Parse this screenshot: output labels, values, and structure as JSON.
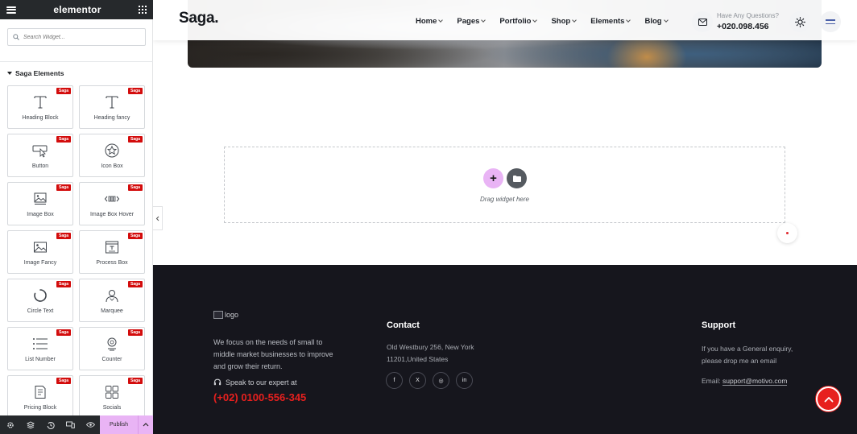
{
  "panel": {
    "title": "elementor",
    "search_placeholder": "Search Widget...",
    "category": "Saga Elements",
    "badge": "Saga",
    "widgets": [
      {
        "label": "Heading Block",
        "icon": "heading-icon"
      },
      {
        "label": "Heading fancy",
        "icon": "heading-icon"
      },
      {
        "label": "Button",
        "icon": "button-icon"
      },
      {
        "label": "Icon Box",
        "icon": "star-icon"
      },
      {
        "label": "Image Box",
        "icon": "image-icon"
      },
      {
        "label": "Image Box Hover",
        "icon": "image-hover-icon"
      },
      {
        "label": "Image Fancy",
        "icon": "image-icon"
      },
      {
        "label": "Process Box",
        "icon": "process-icon"
      },
      {
        "label": "Circle Text",
        "icon": "circle-icon"
      },
      {
        "label": "Marquee",
        "icon": "person-icon"
      },
      {
        "label": "List Number",
        "icon": "list-icon"
      },
      {
        "label": "Counter",
        "icon": "counter-icon"
      },
      {
        "label": "Pricing Block",
        "icon": "pricing-icon"
      },
      {
        "label": "Socials",
        "icon": "socials-icon"
      }
    ],
    "footer": {
      "publish_label": "Publish"
    }
  },
  "header": {
    "logo": "Saga.",
    "nav": [
      {
        "label": "Home"
      },
      {
        "label": "Pages"
      },
      {
        "label": "Portfolio"
      },
      {
        "label": "Shop"
      },
      {
        "label": "Elements"
      },
      {
        "label": "Blog"
      }
    ],
    "have_questions": "Have Any Questions?",
    "phone": "+020.098.456"
  },
  "canvas": {
    "drag_text": "Drag widget here",
    "add_symbol": "+"
  },
  "footer": {
    "logo_alt": "logo",
    "about": "We focus on the needs of small to middle market businesses to improve and grow their return.",
    "speak": "Speak to our expert at",
    "phone": "(+02) 0100-556-345",
    "contact": {
      "title": "Contact",
      "address_line1": "Old Westbury 256, New York",
      "address_line2": "11201,United States",
      "socials": [
        {
          "icon": "facebook-icon",
          "glyph": "f"
        },
        {
          "icon": "x-icon",
          "glyph": "X"
        },
        {
          "icon": "dribbble-icon",
          "glyph": "◎"
        },
        {
          "icon": "linkedin-icon",
          "glyph": "in"
        }
      ]
    },
    "support": {
      "title": "Support",
      "text": "If you have a General enquiry, please drop me an email",
      "email_label": "Email: ",
      "email": "support@motivo.com"
    }
  },
  "colors": {
    "accent": "#e7201e",
    "publish": "#e9b4f5",
    "panel_dark": "#26292c",
    "footer_bg": "#16161d",
    "badge": "#d30c0c"
  }
}
